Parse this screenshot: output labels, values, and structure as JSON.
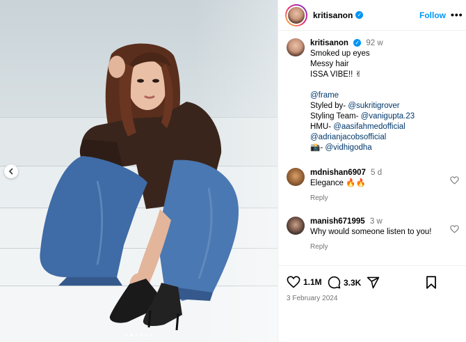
{
  "post": {
    "username": "kritisanon",
    "follow_label": "Follow",
    "more_label": "•••",
    "caption": {
      "username": "kritisanon",
      "time": "92 w",
      "lines": [
        "Smoked up eyes",
        "Messy hair",
        "ISSA VIBE!! ✌"
      ],
      "frame": "@frame",
      "styled_by_label": "Styled by- ",
      "styled_by_handle": "@sukritigrover",
      "styling_team_label": "Styling Team- ",
      "styling_team_handle": "@vanigupta.23",
      "hmu_label": "HMU- ",
      "hmu_handle": "@aasifahmedofficial",
      "hmu_handle2": "@adrianjacobsofficial",
      "camera_prefix": "📸- ",
      "camera_handle": "@vidhigodha"
    },
    "comments": [
      {
        "username": "mdnishan6907",
        "time": "5 d",
        "text": "Elegance 🔥🔥",
        "reply": "Reply"
      },
      {
        "username": "manish671995",
        "time": "3 w",
        "text": "Why would someone listen to you!",
        "reply": "Reply"
      }
    ],
    "likes": "1.1M",
    "comment_count": "3.3K",
    "date": "3 February 2024"
  },
  "carousel": {
    "slides": 6,
    "active_index": 1
  },
  "colors": {
    "accent": "#0095f6",
    "link": "#00376b",
    "muted": "#737373"
  }
}
